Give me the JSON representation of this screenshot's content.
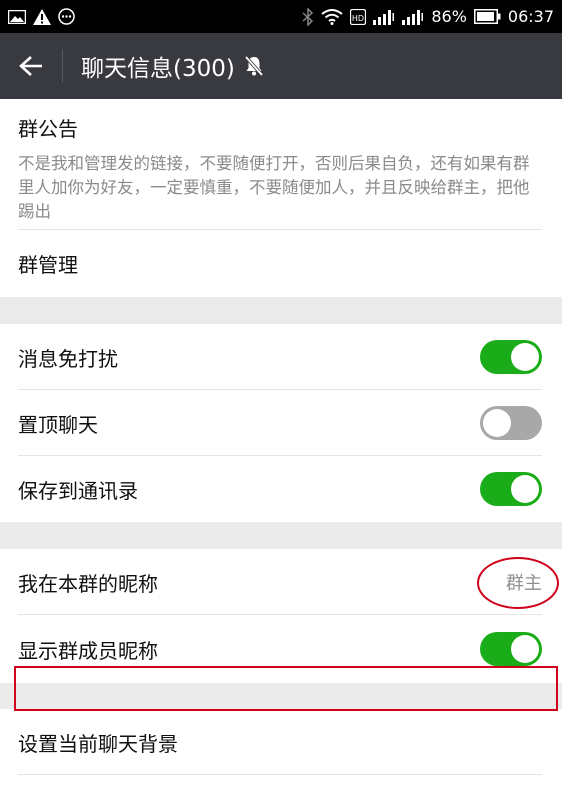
{
  "status_bar": {
    "battery": "86%",
    "time": "06:37"
  },
  "header": {
    "title": "聊天信息(300)"
  },
  "notice": {
    "title": "群公告",
    "text": "不是我和管理发的链接，不要随便打开，否则后果自负，还有如果有群里人加你为好友，一定要慎重，不要随便加人，并且反映给群主，把他踢出"
  },
  "group_manage": {
    "label": "群管理"
  },
  "settings": [
    {
      "label": "消息免打扰",
      "on": true
    },
    {
      "label": "置顶聊天",
      "on": false
    },
    {
      "label": "保存到通讯录",
      "on": true
    }
  ],
  "nickname": {
    "label": "我在本群的昵称",
    "value": "群主"
  },
  "show_nicknames": {
    "label": "显示群成员昵称",
    "on": true
  },
  "background": {
    "label": "设置当前聊天背景"
  },
  "colors": {
    "accent_on": "#1aad19",
    "toggle_off": "#a8a8a8",
    "annotation": "#d0021b",
    "header_bg": "#393a3f"
  },
  "icons": [
    "image-icon",
    "warning-icon",
    "chat-bubble-icon",
    "bluetooth-icon",
    "wifi-icon",
    "hd-icon",
    "signal-icon",
    "battery-icon",
    "back-arrow-icon",
    "mute-bell-icon"
  ]
}
